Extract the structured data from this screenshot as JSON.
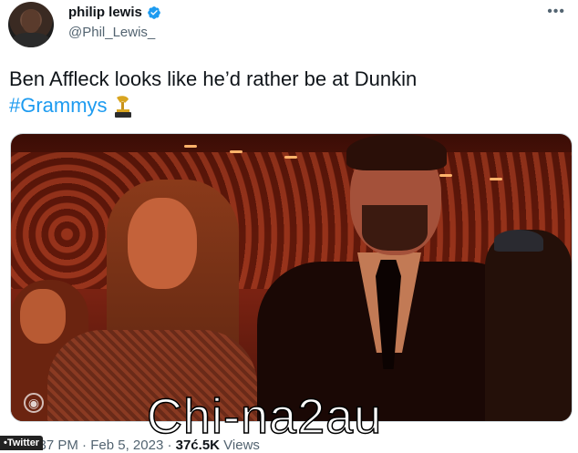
{
  "author": {
    "display_name": "philip lewis",
    "handle": "@Phil_Lewis_",
    "verified": true,
    "avatar_icon": "profile-avatar"
  },
  "menu_label": "•••",
  "tweet": {
    "text": "Ben Affleck looks like he’d rather be at Dunkin",
    "hashtag": "#Grammys",
    "hashtag_emoji_icon": "grammy-trophy-icon",
    "accent_color": "#1d9bf0"
  },
  "media": {
    "network_logo_icon": "cbs-eye-icon"
  },
  "meta": {
    "time": "6:37 PM",
    "date": "Feb 5, 2023",
    "views_count": "37ć.5K",
    "views_label": "Views",
    "separator": "·"
  },
  "overlay": {
    "watermark_text": "Chi-na2au",
    "source_badge": "•Twitter"
  }
}
